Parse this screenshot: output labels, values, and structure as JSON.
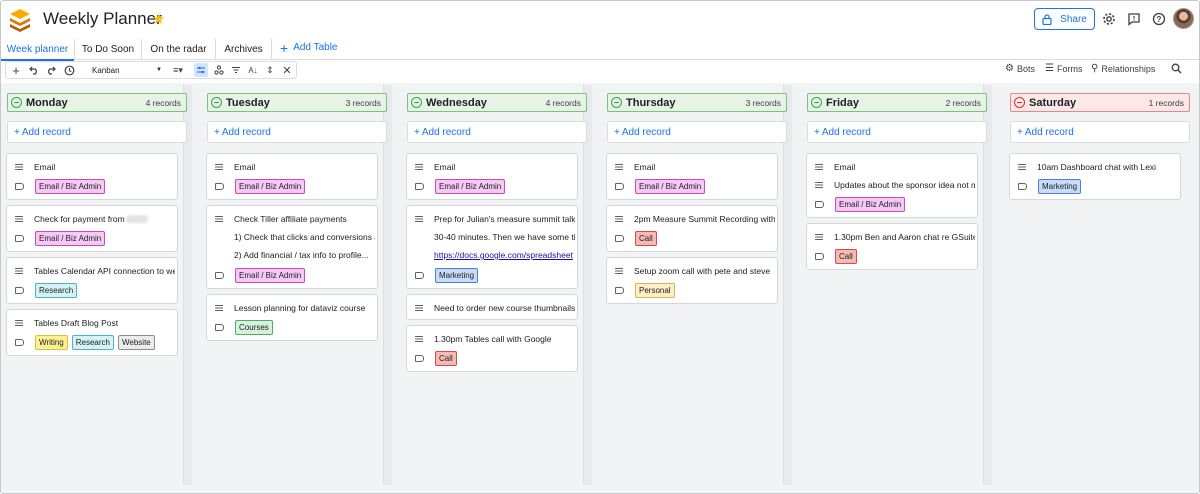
{
  "app": {
    "title": "Weekly Planner",
    "share_label": "Share"
  },
  "tabs": [
    {
      "label": "Week planner",
      "active": true
    },
    {
      "label": "To Do Soon"
    },
    {
      "label": "On the radar"
    },
    {
      "label": "Archives"
    }
  ],
  "add_table_label": "Add Table",
  "toolbar": {
    "view_label": "Kanban",
    "bots_label": "Bots",
    "forms_label": "Forms",
    "relationships_label": "Relationships"
  },
  "add_record_label": "Add record",
  "columns": [
    {
      "name": "Monday",
      "count": "4 records",
      "color": "green",
      "cards": [
        {
          "lines": [
            "Email"
          ],
          "tags": [
            {
              "label": "Email / Biz Admin",
              "kind": "biz"
            }
          ]
        },
        {
          "lines": [
            "Check for payment from"
          ],
          "redacted": true,
          "tags": [
            {
              "label": "Email / Biz Admin",
              "kind": "biz"
            }
          ]
        },
        {
          "lines": [
            "Tables Calendar API connection to we"
          ],
          "tags": [
            {
              "label": "Research",
              "kind": "research"
            }
          ]
        },
        {
          "lines": [
            "Tables Draft Blog Post"
          ],
          "tags": [
            {
              "label": "Writing",
              "kind": "writing"
            },
            {
              "label": "Research",
              "kind": "research"
            },
            {
              "label": "Website",
              "kind": "website"
            }
          ]
        }
      ]
    },
    {
      "name": "Tuesday",
      "count": "3 records",
      "color": "green",
      "cards": [
        {
          "lines": [
            "Email"
          ],
          "tags": [
            {
              "label": "Email / Biz Admin",
              "kind": "biz"
            }
          ]
        },
        {
          "lines": [
            "Check Tiller affiliate payments",
            "1) Check that clicks and conversions a",
            "2) Add financial / tax info to profile..."
          ],
          "tags": [
            {
              "label": "Email / Biz Admin",
              "kind": "biz"
            }
          ]
        },
        {
          "lines": [
            "Lesson planning for dataviz course"
          ],
          "tags": [
            {
              "label": "Courses",
              "kind": "courses"
            }
          ]
        }
      ]
    },
    {
      "name": "Wednesday",
      "count": "4 records",
      "color": "green",
      "cards": [
        {
          "lines": [
            "Email"
          ],
          "tags": [
            {
              "label": "Email / Biz Admin",
              "kind": "biz"
            }
          ]
        },
        {
          "lines": [
            "Prep for Julian's measure summit talk",
            "30-40 minutes. Then we have some tir",
            "https://docs.google.com/spreadsheet"
          ],
          "link_line": 2,
          "tags": [
            {
              "label": "Marketing",
              "kind": "marketing"
            }
          ]
        },
        {
          "lines": [
            "Need to order new course thumbnails"
          ],
          "tags": []
        },
        {
          "lines": [
            "1.30pm Tables call with Google"
          ],
          "tags": [
            {
              "label": "Call",
              "kind": "call"
            }
          ]
        }
      ]
    },
    {
      "name": "Thursday",
      "count": "3 records",
      "color": "green",
      "cards": [
        {
          "lines": [
            "Email"
          ],
          "tags": [
            {
              "label": "Email / Biz Admin",
              "kind": "biz"
            }
          ]
        },
        {
          "lines": [
            "2pm Measure Summit Recording with"
          ],
          "tags": [
            {
              "label": "Call",
              "kind": "call"
            }
          ]
        },
        {
          "lines": [
            "Setup zoom call with pete and steve"
          ],
          "tags": [
            {
              "label": "Personal",
              "kind": "personal"
            }
          ]
        }
      ]
    },
    {
      "name": "Friday",
      "count": "2 records",
      "color": "green",
      "cards": [
        {
          "lines": [
            "Email",
            "Updates about the sponsor idea not m"
          ],
          "tags": [
            {
              "label": "Email / Biz Admin",
              "kind": "biz"
            }
          ]
        },
        {
          "lines": [
            "1.30pm Ben and Aaron chat re GSuite"
          ],
          "tags": [
            {
              "label": "Call",
              "kind": "call"
            }
          ]
        }
      ]
    },
    {
      "name": "Saturday",
      "count": "1 records",
      "color": "red",
      "cards": [
        {
          "lines": [
            "10am Dashboard chat with Lexi"
          ],
          "tags": [
            {
              "label": "Marketing",
              "kind": "marketing"
            }
          ]
        }
      ]
    }
  ]
}
